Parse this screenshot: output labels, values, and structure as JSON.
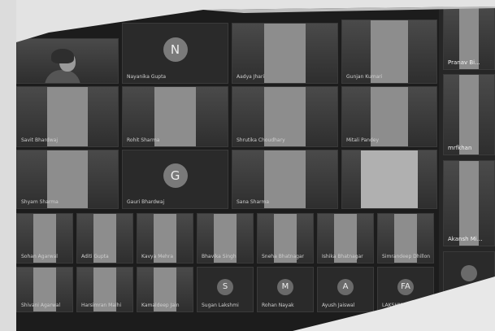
{
  "meeting": {
    "grid_row1": [
      {
        "name": "",
        "type": "video"
      },
      {
        "name": "Nayanika Gupta",
        "type": "avatar",
        "initial": "N"
      },
      {
        "name": "Aadya Jhari",
        "type": "video"
      },
      {
        "name": "Gunjan Kumari",
        "type": "video"
      }
    ],
    "grid_row2": [
      {
        "name": "Savit Bhardwaj",
        "type": "video"
      },
      {
        "name": "Rohit Sharma",
        "type": "video"
      },
      {
        "name": "Shrutika Choudhary",
        "type": "video"
      },
      {
        "name": "Mitali Pandey",
        "type": "video"
      }
    ],
    "grid_row3": [
      {
        "name": "Shyam Sharma",
        "type": "video"
      },
      {
        "name": "Gauri Bhardwaj",
        "type": "avatar",
        "initial": "G"
      },
      {
        "name": "Sana Sharma",
        "type": "video"
      },
      {
        "name": "",
        "type": "video"
      }
    ],
    "small_row1": [
      {
        "name": "Sohan Agarwal"
      },
      {
        "name": "Aditi Gupta"
      },
      {
        "name": "Kavya Mehra"
      },
      {
        "name": "Bhavika Singh"
      },
      {
        "name": "Sneha Bhatnagar"
      },
      {
        "name": "Ishika Bhatnagar"
      },
      {
        "name": "Simrandeep Dhillon"
      }
    ],
    "small_row2": [
      {
        "name": "Shivani Agarwal",
        "type": "video"
      },
      {
        "name": "Harsimran Malhi",
        "type": "video"
      },
      {
        "name": "Kamaldeep Jain",
        "type": "video"
      },
      {
        "name": "Sugan Lakshmi",
        "type": "avatar",
        "initial": "S"
      },
      {
        "name": "Rohan Nayak",
        "type": "avatar",
        "initial": "M"
      },
      {
        "name": "Ayush Jaiswal",
        "type": "avatar",
        "initial": "A"
      },
      {
        "name": "LAKSHMI MAHATRE",
        "type": "avatar",
        "initial": "FA"
      }
    ],
    "side_tiles": [
      {
        "name": "Pranav Bi..."
      },
      {
        "name": "mrfkhan"
      },
      {
        "name": "Akansh Mi..."
      },
      {
        "name": ""
      }
    ]
  },
  "colors": {
    "bg": "#1c1c1c",
    "tile": "#2a2a2a",
    "paper": "#d9d9d9"
  }
}
